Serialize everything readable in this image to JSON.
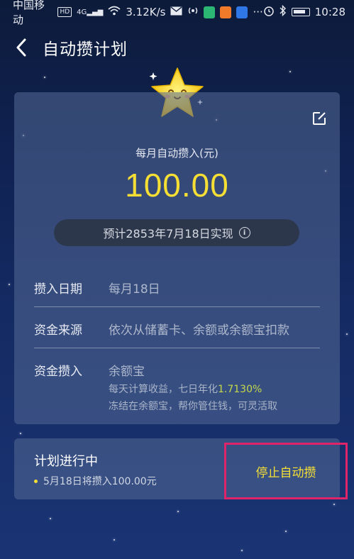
{
  "status_bar": {
    "carrier": "中国移动",
    "hd": "HD",
    "signal": "4G",
    "speed": "3.12K/s",
    "time": "10:28"
  },
  "header": {
    "title": "自动攒计划"
  },
  "plan": {
    "amount_label": "每月自动攒入(元)",
    "amount": "100.00",
    "projection": "预计2853年7月18日实现",
    "rows": [
      {
        "label": "攒入日期",
        "value": "每月18日"
      },
      {
        "label": "资金来源",
        "value": "依次从储蓄卡、余额或余额宝扣款"
      },
      {
        "label": "资金攒入",
        "value": "余额宝"
      }
    ],
    "yield_prefix": "每天计算收益，七日年化",
    "yield_rate": "1.7130%",
    "yield_note": "冻结在余额宝，帮你管住钱，可灵活取"
  },
  "status_card": {
    "title": "计划进行中",
    "next": "5月18日将攒入100.00元",
    "stop_label": "停止自动攒"
  },
  "colors": {
    "accent": "#f6df35",
    "highlight_border": "#e0246a",
    "background_top": "#0d1b3a",
    "background_bottom": "#1a3474"
  }
}
